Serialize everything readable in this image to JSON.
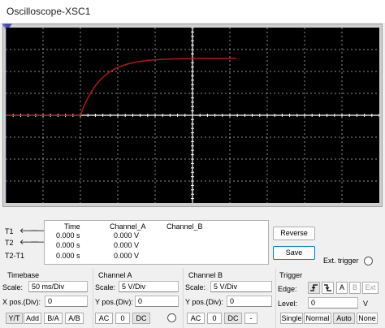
{
  "window": {
    "title": "Oscilloscope-XSC1"
  },
  "trace": {
    "color": "#b01818",
    "axis_color": "#ffffff",
    "grid_color": "#ffffff",
    "background": "#000000"
  },
  "readout": {
    "rows": [
      {
        "label": "T1",
        "time": "0.000 s",
        "channel_a": "0.000 V",
        "channel_b": ""
      },
      {
        "label": "T2",
        "time": "0.000 s",
        "channel_a": "0.000 V",
        "channel_b": ""
      },
      {
        "label": "T2-T1",
        "time": "0.000 s",
        "channel_a": "0.000 V",
        "channel_b": ""
      }
    ],
    "headers": {
      "time": "Time",
      "channel_a": "Channel_A",
      "channel_b": "Channel_B"
    },
    "arrow_left": "🡐",
    "arrow_right": "🡒"
  },
  "actions": {
    "reverse": "Reverse",
    "save": "Save",
    "ext_trigger": "Ext. trigger"
  },
  "timebase": {
    "title": "Timebase",
    "scale_label": "Scale:",
    "scale_value": "50 ms/Div",
    "xpos_label": "X pos.(Div):",
    "xpos_value": "0",
    "buttons": [
      "Y/T",
      "Add",
      "B/A",
      "A/B"
    ]
  },
  "channel_a": {
    "title": "Channel A",
    "scale_label": "Scale:",
    "scale_value": "5  V/Div",
    "ypos_label": "Y pos.(Div):",
    "ypos_value": "0",
    "buttons": [
      "AC",
      "0",
      "DC"
    ]
  },
  "channel_b": {
    "title": "Channel B",
    "scale_label": "Scale:",
    "scale_value": "5  V/Div",
    "ypos_label": "Y pos.(Div):",
    "ypos_value": "0",
    "buttons": [
      "AC",
      "0",
      "DC",
      "-"
    ]
  },
  "trigger": {
    "title": "Trigger",
    "edge_label": "Edge:",
    "edge_buttons": [
      "rising-edge-icon",
      "falling-edge-icon"
    ],
    "source_buttons": [
      "A",
      "B",
      "Ext"
    ],
    "level_label": "Level:",
    "level_value": "0",
    "level_unit": "V",
    "mode_buttons": [
      "Single",
      "Normal",
      "Auto",
      "None"
    ]
  }
}
